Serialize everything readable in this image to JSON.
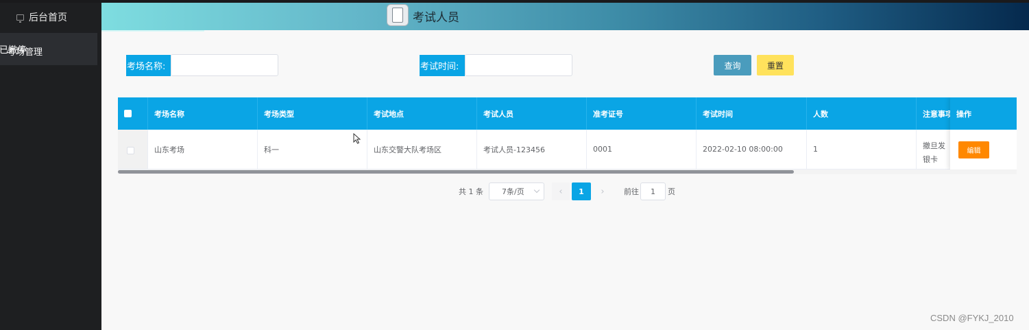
{
  "sidebar": {
    "home_label": "后台首页",
    "item_overlap_text_1": "已撤停",
    "item_overlap_text_2": "考场管理"
  },
  "header": {
    "title": "考试人员"
  },
  "filters": {
    "exam_site_label": "考场名称:",
    "exam_site_value": "",
    "exam_time_label": "考试时间:",
    "exam_time_value": "",
    "query_label": "查询",
    "reset_label": "重置"
  },
  "table": {
    "columns": [
      "考场名称",
      "考场类型",
      "考试地点",
      "考试人员",
      "准考证号",
      "考试时间",
      "人数",
      "注意事项",
      "操作"
    ],
    "rows": [
      {
        "site_name": "山东考场",
        "site_type": "科一",
        "location": "山东交警大队考场区",
        "examinee": "考试人员-123456",
        "admission_no": "0001",
        "exam_time": "2022-02-10 08:00:00",
        "count": "1",
        "notes": "撤旦发银卡",
        "edit_label": "编辑"
      }
    ]
  },
  "pagination": {
    "total_text": "共 1 条",
    "page_size_text": "7条/页",
    "prev_symbol": "‹",
    "next_symbol": "›",
    "current_page": "1",
    "goto_label": "前往",
    "goto_value": "1",
    "goto_suffix": "页"
  },
  "watermark": "CSDN @FYKJ_2010",
  "colors": {
    "accent": "#0aa5e5",
    "query_button": "#4a9cbd",
    "reset_button": "#ffe25c",
    "edit_button": "#ff8800",
    "sidebar_bg": "#1e1f21"
  }
}
